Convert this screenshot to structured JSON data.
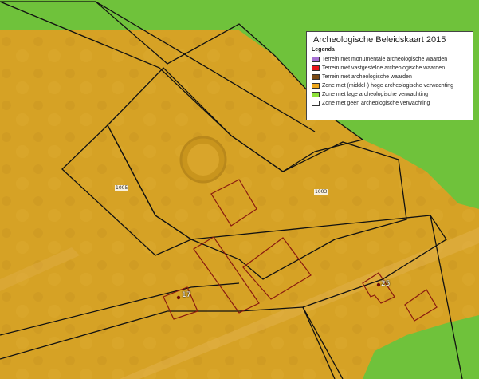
{
  "legend": {
    "title": "Archeologische Beleidskaart 2015",
    "subtitle": "Legenda",
    "items": [
      {
        "label": "Terrein met monumentale archeologische waarden",
        "color": "#a771d4"
      },
      {
        "label": "Terrein met vastgestelde archeologische waarden",
        "color": "#e8161a"
      },
      {
        "label": "Terrein met archeologische waarden",
        "color": "#7a4a14"
      },
      {
        "label": "Zone met (middel-) hoge archeologische verwachting",
        "color": "#f0a81c"
      },
      {
        "label": "Zone met lage archeologische verwachting",
        "color": "#8ee23a"
      },
      {
        "label": "Zone met geen archeologische verwachting",
        "color": "#ffffff"
      }
    ]
  },
  "parcels": {
    "parcel_1005": "1005",
    "parcel_1003": "1003"
  },
  "points": {
    "point_17": "17",
    "point_25": "25"
  },
  "colors": {
    "zone_high": "#d8a020",
    "zone_low": "#74c63a",
    "outline": "#111111",
    "value_outline": "#8a1a10"
  }
}
